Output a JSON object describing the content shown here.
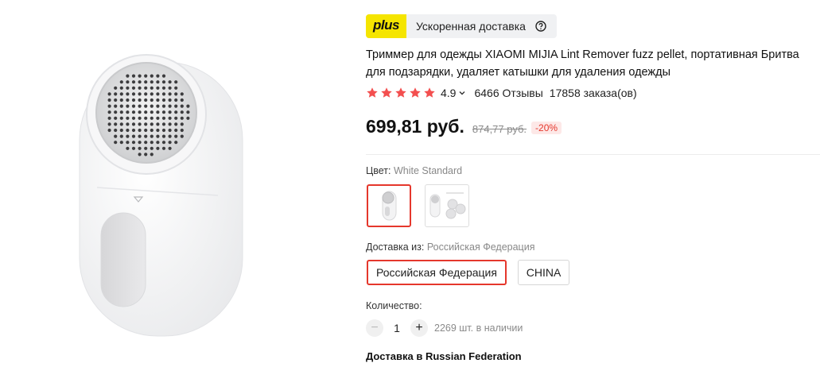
{
  "plus_badge": {
    "logo": "plus",
    "text": "Ускоренная доставка"
  },
  "product": {
    "title": "Триммер для одежды XIAOMI MIJIA Lint Remover fuzz pellet, портативная Бритва для подзарядки, удаляет катышки для удаления одежды",
    "rating": "4.9",
    "reviews": "6466 Отзывы",
    "orders": "17858 заказа(ов)",
    "price": "699,81 руб.",
    "old_price": "874,77 руб.",
    "discount": "-20%"
  },
  "color": {
    "label": "Цвет:",
    "value": "White Standard",
    "options": [
      "White Standard",
      "Bundle"
    ]
  },
  "shipping": {
    "label": "Доставка из:",
    "value": "Российская Федерация",
    "options": [
      "Российская Федерация",
      "CHINA"
    ]
  },
  "quantity": {
    "label": "Количество:",
    "value": "1",
    "minus": "−",
    "plus": "+",
    "stock": "2269 шт. в наличии"
  },
  "delivery_heading": "Доставка в Russian Federation",
  "colors": {
    "accent": "#e5372c",
    "plus_yellow": "#f5e500",
    "star": "#f34f4f"
  }
}
